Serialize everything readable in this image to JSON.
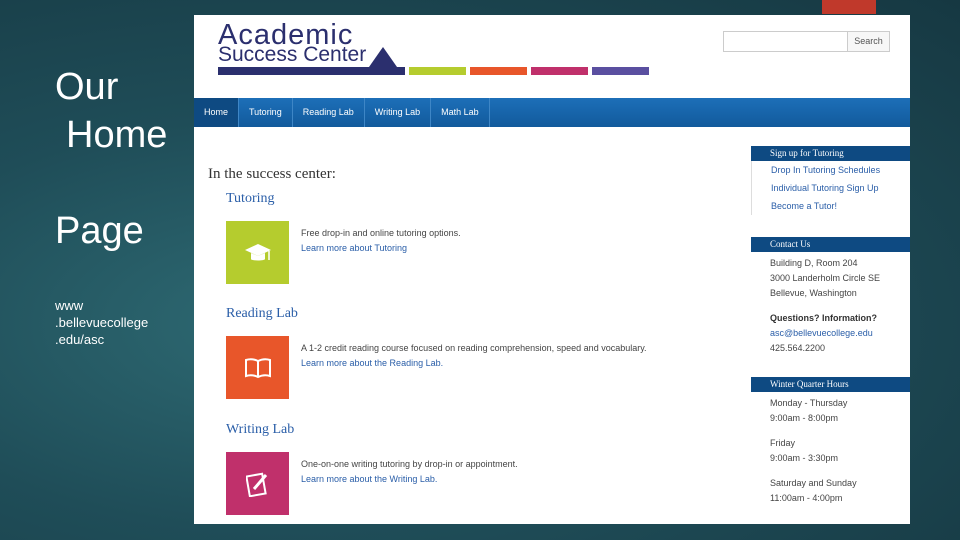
{
  "slide": {
    "title_line1": "Our",
    "title_line2": "Home",
    "title_line3": "Page",
    "url_line1": "www",
    "url_line2": ".bellevuecollege",
    "url_line3": ".edu/asc"
  },
  "site": {
    "logo_line1": "Academic",
    "logo_line2": "Success Center",
    "brand_colors": [
      "#2b2f6e",
      "#b5cc2e",
      "#e8562a",
      "#c0306b",
      "#5a4fa0"
    ],
    "search_button": "Search",
    "search_placeholder": "",
    "nav": [
      "Home",
      "Tutoring",
      "Reading Lab",
      "Writing Lab",
      "Math Lab"
    ],
    "section_heading": "In the success center:",
    "services": [
      {
        "title": "Tutoring",
        "icon": "graduation-cap-icon",
        "color": "#b5cc2e",
        "description": "Free drop-in and online tutoring options.",
        "link": "Learn more about Tutoring"
      },
      {
        "title": "Reading Lab",
        "icon": "book-icon",
        "color": "#e8562a",
        "description": "A 1-2 credit reading course focused on reading comprehension, speed and vocabulary.",
        "link": "Learn more about the Reading Lab."
      },
      {
        "title": "Writing Lab",
        "icon": "pencil-paper-icon",
        "color": "#c0306b",
        "description": "One-on-one writing tutoring by drop-in or appointment.",
        "link": "Learn more about the Writing Lab."
      }
    ],
    "sidebar": {
      "tutoring_heading": "Sign up for Tutoring",
      "tutoring_links": [
        "Drop In Tutoring Schedules",
        "Individual Tutoring Sign Up",
        "Become a Tutor!"
      ],
      "contact_heading": "Contact Us",
      "contact_lines": [
        "Building D, Room 204",
        "3000 Landerholm Circle SE",
        "Bellevue, Washington"
      ],
      "questions": "Questions? Information?",
      "email": "asc@bellevuecollege.edu",
      "phone": "425.564.2200",
      "hours_heading": "Winter Quarter Hours",
      "hours": [
        {
          "days": "Monday - Thursday",
          "time": "9:00am - 8:00pm"
        },
        {
          "days": "Friday",
          "time": "9:00am - 3:30pm"
        },
        {
          "days": "Saturday and Sunday",
          "time": "11:00am - 4:00pm"
        }
      ]
    }
  }
}
